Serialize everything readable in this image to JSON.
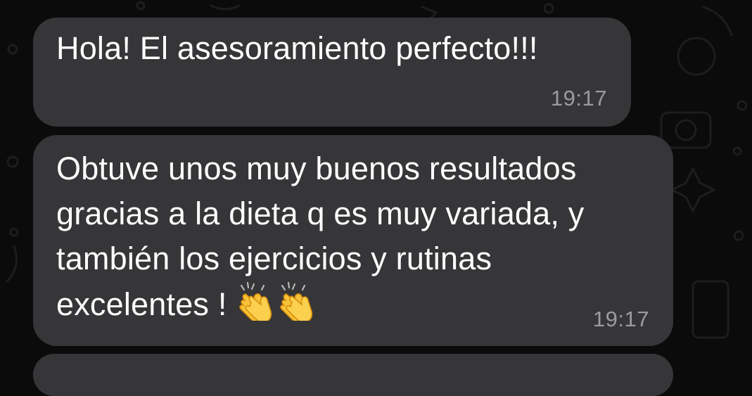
{
  "theme": {
    "background": "#0b0b0b",
    "bubble": "#363638",
    "text": "#ffffff",
    "timestamp": "#9b9b9f"
  },
  "messages": [
    {
      "text": "Hola! El asesoramiento perfecto!!!",
      "time": "19:17"
    },
    {
      "text": "Obtuve unos muy buenos resultados\ngracias a la dieta q es muy variada, y\ntambién los ejercicios y rutinas\nexcelentes !",
      "emojis": [
        "clapping-hands",
        "clapping-hands"
      ],
      "time": "19:17"
    }
  ]
}
